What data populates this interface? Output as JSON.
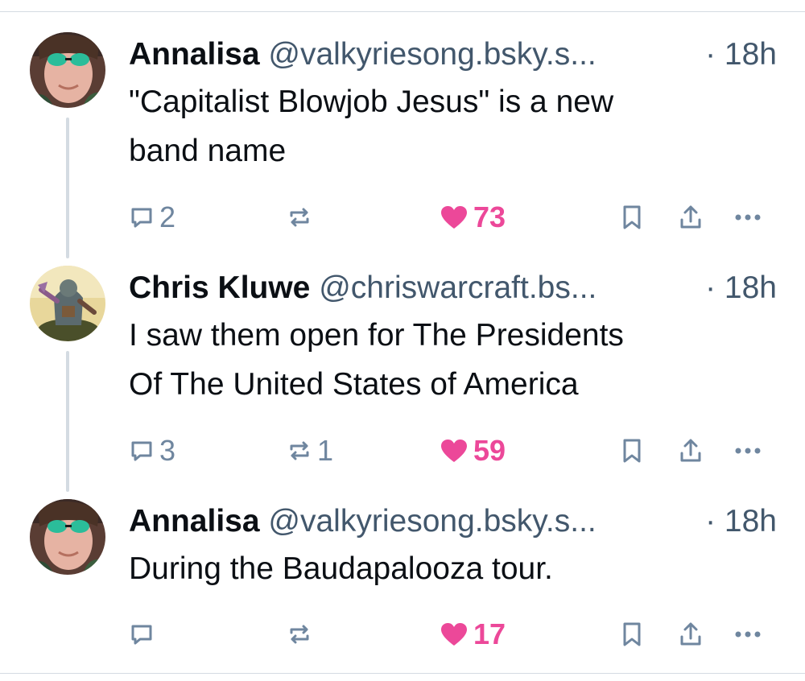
{
  "colors": {
    "text": "#0b0f14",
    "muted": "#42576c",
    "icon": "#6f869f",
    "like": "#ec4899",
    "divider": "#d4dbe2"
  },
  "posts": [
    {
      "display_name": "Annalisa",
      "handle": "@valkyriesong.bsky.s...",
      "time": "· 18h",
      "text_lines": [
        "\"Capitalist Blowjob Jesus\" is a new",
        "band name"
      ],
      "replies": "2",
      "reposts": "",
      "likes": "73",
      "liked": true,
      "avatar": "sunglasses-woman-avatar"
    },
    {
      "display_name": "Chris Kluwe",
      "handle": "@chriswarcraft.bs...",
      "time": "· 18h",
      "text_lines": [
        "I saw them open for The Presidents",
        "Of The United States of America"
      ],
      "replies": "3",
      "reposts": "1",
      "likes": "59",
      "liked": true,
      "avatar": "miniature-figure-avatar"
    },
    {
      "display_name": "Annalisa",
      "handle": "@valkyriesong.bsky.s...",
      "time": "· 18h",
      "text_lines": [
        "During the Baudapalooza tour."
      ],
      "replies": "",
      "reposts": "",
      "likes": "17",
      "liked": true,
      "avatar": "sunglasses-woman-avatar"
    }
  ]
}
